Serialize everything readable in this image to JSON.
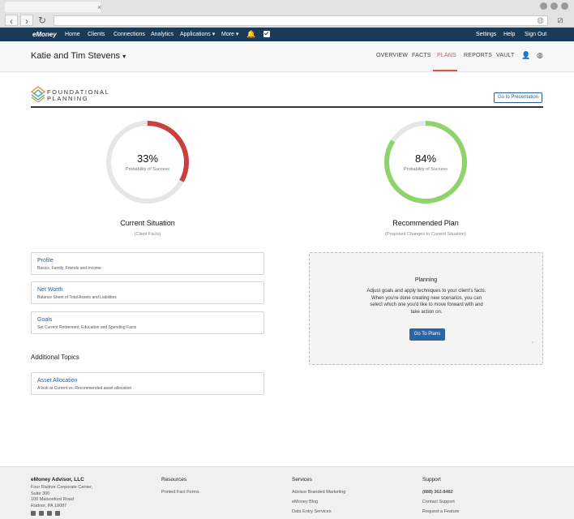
{
  "browser": {
    "tab_close": "×",
    "back": "‹",
    "forward": "›",
    "reload": "↻",
    "globe": "◍",
    "extension": "⧄"
  },
  "appnav": {
    "logo": "eMoney",
    "items": [
      "Home",
      "Clients",
      "Connections",
      "Analytics",
      "Applications ▾",
      "More ▾"
    ],
    "bell": "🔔",
    "right": [
      "Settings",
      "Help",
      "Sign Out"
    ]
  },
  "client": {
    "name": "Katie and Tim Stevens",
    "caret": "▾",
    "tabs": [
      "OVERVIEW",
      "FACTS",
      "PLANS",
      "REPORTS",
      "VAULT"
    ],
    "active_tab": "PLANS",
    "user_icon": "👤",
    "globe_icon": "◍"
  },
  "header": {
    "title_line1": "FOUNDATIONAL",
    "title_line2": "PLANNING",
    "presentation_button": "Go to Presentation"
  },
  "current": {
    "percent": 33,
    "percent_label": "33%",
    "sub_label": "Probability of Success",
    "title": "Current Situation",
    "subtitle": "(Client Facts)",
    "color": "#c94040"
  },
  "recommended": {
    "percent": 84,
    "percent_label": "84%",
    "sub_label": "Probability of Success",
    "title": "Recommended Plan",
    "subtitle": "(Proposed Changes to Current Situation)",
    "color": "#8fd46a"
  },
  "cards": [
    {
      "title": "Profile",
      "desc": "Basics, Family, Friends and Income"
    },
    {
      "title": "Net Worth",
      "desc": "Balance Sheet of Total Assets and Liabilities"
    },
    {
      "title": "Goals",
      "desc": "Set Current Retirement, Education and Spending Facts"
    }
  ],
  "additional": {
    "title": "Additional Topics",
    "card": {
      "title": "Asset Allocation",
      "desc": "A look at Current vs. Recommended asset allocation"
    }
  },
  "planning": {
    "title": "Planning",
    "text": "Adjust goals and apply techniques to your client's facts. When you're done creating new scenarios, you can select which one you'd like to move forward with and take action on.",
    "button": "Go To Plans",
    "arrow": "›"
  },
  "footer": {
    "company": {
      "name": "eMoney Advisor, LLC",
      "lines": [
        "Four Radnor Corporate Center,",
        "Suite 300",
        "100 Matsonford Road",
        "Radnor, PA 19087"
      ]
    },
    "resources": {
      "head": "Resources",
      "links": [
        "Printed Fact Forms"
      ]
    },
    "services": {
      "head": "Services",
      "links": [
        "Advisor Branded Marketing",
        "eMoney Blog",
        "Data Entry Services"
      ]
    },
    "support": {
      "head": "Support",
      "phone": "(888) 362-8482",
      "links": [
        "Contact Support",
        "Request a Feature"
      ]
    }
  },
  "colors": {
    "nav_bg": "#1b3a57",
    "accent_red": "#d9534f",
    "link_blue": "#2a5f93",
    "ring_track": "#e6e6e6"
  }
}
